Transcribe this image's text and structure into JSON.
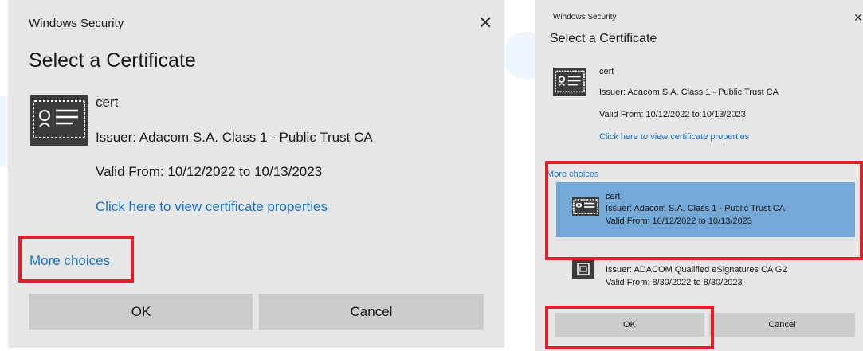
{
  "colors": {
    "dialog_bg": "#e6e6e6",
    "button_bg": "#cccccc",
    "link": "#1a73c9",
    "selected_bg": "#74a8d6",
    "highlight_red": "#e01f2a"
  },
  "left_dialog": {
    "window_title": "Windows Security",
    "close_glyph": "✕",
    "heading": "Select a Certificate",
    "certificate": {
      "icon": "certificate-icon",
      "name": "cert",
      "issuer": "Issuer: Adacom S.A. Class 1 - Public Trust CA",
      "valid": "Valid From: 10/12/2022 to 10/13/2023",
      "properties_link": "Click here to view certificate properties"
    },
    "more_choices": "More choices",
    "ok_label": "OK",
    "cancel_label": "Cancel"
  },
  "right_dialog": {
    "window_title": "Windows Security",
    "close_glyph": "✕",
    "heading": "Select a Certificate",
    "certificate": {
      "icon": "certificate-icon",
      "name": "cert",
      "issuer": "Issuer: Adacom S.A. Class 1 - Public Trust CA",
      "valid": "Valid From: 10/12/2022 to 10/13/2023",
      "properties_link": "Click here to view certificate properties"
    },
    "more_choices": "More choices",
    "list": [
      {
        "icon": "certificate-icon",
        "name": "cert",
        "issuer": "Issuer: Adacom S.A. Class 1 - Public Trust CA",
        "valid": "Valid From: 10/12/2022 to 10/13/2023",
        "selected": true
      },
      {
        "icon": "smartcard-certificate-icon",
        "issuer": "Issuer: ADACOM Qualified eSignatures CA G2",
        "valid": "Valid From: 8/30/2022 to 8/30/2023",
        "selected": false
      }
    ],
    "ok_label": "OK",
    "cancel_label": "Cancel"
  }
}
